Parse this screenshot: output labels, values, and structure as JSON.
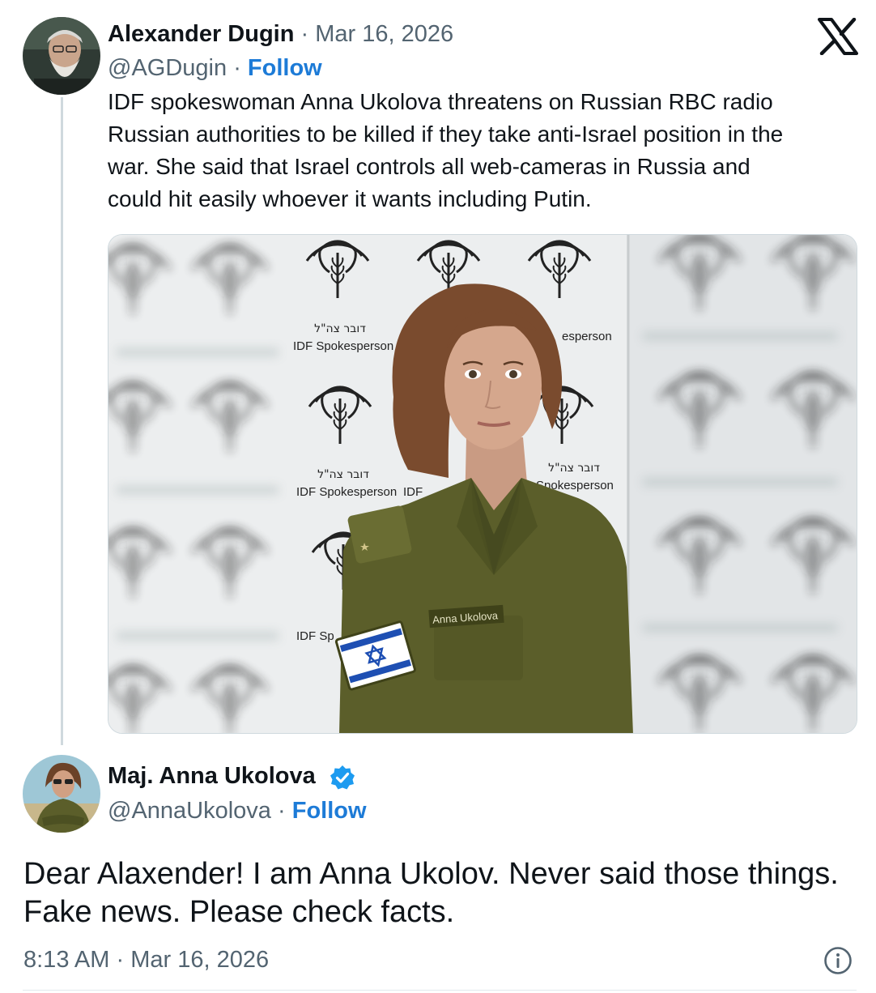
{
  "original_tweet": {
    "author_name": "Alexander Dugin",
    "separator": "·",
    "date": "Mar 16, 2026",
    "handle": "@AGDugin",
    "follow_label": "Follow",
    "text_lines": [
      "IDF spokeswoman Anna Ukolova threatens on Russian RBC radio",
      "Russian authorities to be killed if they take anti-Israel position in the",
      "war. She said that Israel controls all web-cameras in Russia and",
      "could hit easily whoever  it wants including Putin."
    ],
    "media": {
      "backdrop_hebrew": "דובר צה\"ל",
      "backdrop_label": "IDF Spokesperson",
      "backdrop_partial_left": "IDF",
      "backdrop_partial_right": "esperson",
      "backdrop_partial_right2": "Spokesperson",
      "backdrop_partial_sp": "IDF Sp",
      "name_tape": "Anna Ukolova"
    }
  },
  "reply": {
    "author_name": "Maj. Anna Ukolova",
    "handle": "@AnnaUkolova",
    "separator": "·",
    "follow_label": "Follow",
    "text_lines": [
      "Dear Alaxender! I am Anna Ukolov. Never said those things.",
      "Fake news. Please check facts."
    ],
    "time": "8:13 AM",
    "date": "Mar 16, 2026"
  },
  "icons": {
    "platform_logo": "x-logo-icon",
    "verified": "verified-badge-icon",
    "info": "info-icon"
  },
  "colors": {
    "follow_blue": "#1d7bd7",
    "verified_blue": "#1d9bf0",
    "muted_text": "#536471",
    "uniform_green": "#5b5e2a"
  }
}
